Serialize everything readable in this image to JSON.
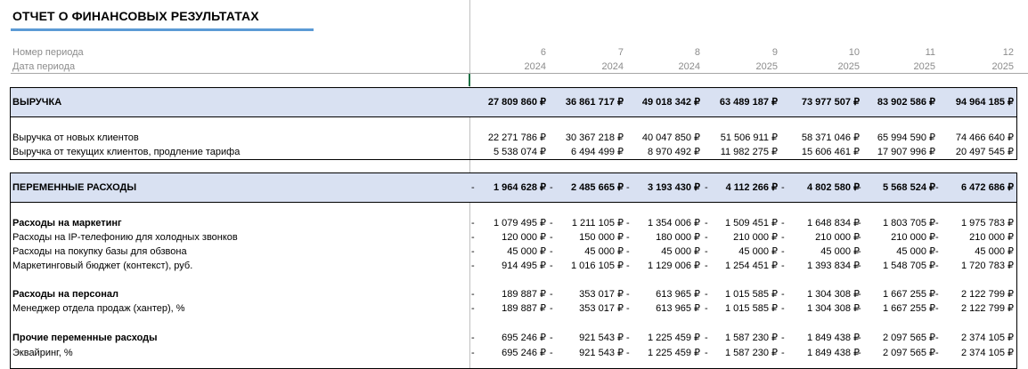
{
  "title": "ОТЧЕТ О ФИНАНСОВЫХ РЕЗУЛЬТАТАХ",
  "header": {
    "period_label": "Номер периода",
    "date_label": "Дата периода",
    "periods": [
      "6",
      "7",
      "8",
      "9",
      "10",
      "11",
      "12"
    ],
    "years": [
      "2024",
      "2024",
      "2024",
      "2025",
      "2025",
      "2025",
      "2025"
    ]
  },
  "revenue": {
    "label": "ВЫРУЧКА",
    "values": [
      "27 809 860 ₽",
      "36 861 717 ₽",
      "49 018 342 ₽",
      "63 489 187 ₽",
      "73 977 507 ₽",
      "83 902 586 ₽",
      "94 964 185 ₽"
    ],
    "rows": [
      {
        "label": "Выручка от новых клиентов",
        "values": [
          "22 271 786 ₽",
          "30 367 218 ₽",
          "40 047 850 ₽",
          "51 506 911 ₽",
          "58 371 046 ₽",
          "65 994 590 ₽",
          "74 466 640 ₽"
        ]
      },
      {
        "label": "Выручка от текущих клиентов, продление тарифа",
        "values": [
          "5 538 074 ₽",
          "6 494 499 ₽",
          "8 970 492 ₽",
          "11 982 275 ₽",
          "15 606 461 ₽",
          "17 907 996 ₽",
          "20 497 545 ₽"
        ]
      }
    ]
  },
  "variable": {
    "label": "ПЕРЕМЕННЫЕ РАСХОДЫ",
    "dash": "-",
    "values": [
      "1 964 628 ₽",
      "2 485 665 ₽",
      "3 193 430 ₽",
      "4 112 266 ₽",
      "4 802 580 ₽",
      "5 568 524 ₽",
      "6 472 686 ₽"
    ],
    "groups": [
      {
        "label": "Расходы на маркетинг",
        "values": [
          "1 079 495 ₽",
          "1 211 105 ₽",
          "1 354 006 ₽",
          "1 509 451 ₽",
          "1 648 834 ₽",
          "1 803 705 ₽",
          "1 975 783 ₽"
        ],
        "rows": [
          {
            "label": "Расходы на IP-телефонию для холодных звонков",
            "values": [
              "120 000 ₽",
              "150 000 ₽",
              "180 000 ₽",
              "210 000 ₽",
              "210 000 ₽",
              "210 000 ₽",
              "210 000 ₽"
            ]
          },
          {
            "label": "Расходы на покупку базы для обзвона",
            "values": [
              "45 000 ₽",
              "45 000 ₽",
              "45 000 ₽",
              "45 000 ₽",
              "45 000 ₽",
              "45 000 ₽",
              "45 000 ₽"
            ]
          },
          {
            "label": "Маркетинговый бюджет (контекст), руб.",
            "values": [
              "914 495 ₽",
              "1 016 105 ₽",
              "1 129 006 ₽",
              "1 254 451 ₽",
              "1 393 834 ₽",
              "1 548 705 ₽",
              "1 720 783 ₽"
            ]
          }
        ]
      },
      {
        "label": "Расходы на персонал",
        "values": [
          "189 887 ₽",
          "353 017 ₽",
          "613 965 ₽",
          "1 015 585 ₽",
          "1 304 308 ₽",
          "1 667 255 ₽",
          "2 122 799 ₽"
        ],
        "rows": [
          {
            "label": "Менеджер отдела продаж (хантер), %",
            "values": [
              "189 887 ₽",
              "353 017 ₽",
              "613 965 ₽",
              "1 015 585 ₽",
              "1 304 308 ₽",
              "1 667 255 ₽",
              "2 122 799 ₽"
            ]
          }
        ]
      },
      {
        "label": "Прочие переменные расходы",
        "values": [
          "695 246 ₽",
          "921 543 ₽",
          "1 225 459 ₽",
          "1 587 230 ₽",
          "1 849 438 ₽",
          "2 097 565 ₽",
          "2 374 105 ₽"
        ],
        "rows": [
          {
            "label": "Эквайринг, %",
            "values": [
              "695 246 ₽",
              "921 543 ₽",
              "1 225 459 ₽",
              "1 587 230 ₽",
              "1 849 438 ₽",
              "2 097 565 ₽",
              "2 374 105 ₽"
            ]
          }
        ]
      }
    ]
  }
}
